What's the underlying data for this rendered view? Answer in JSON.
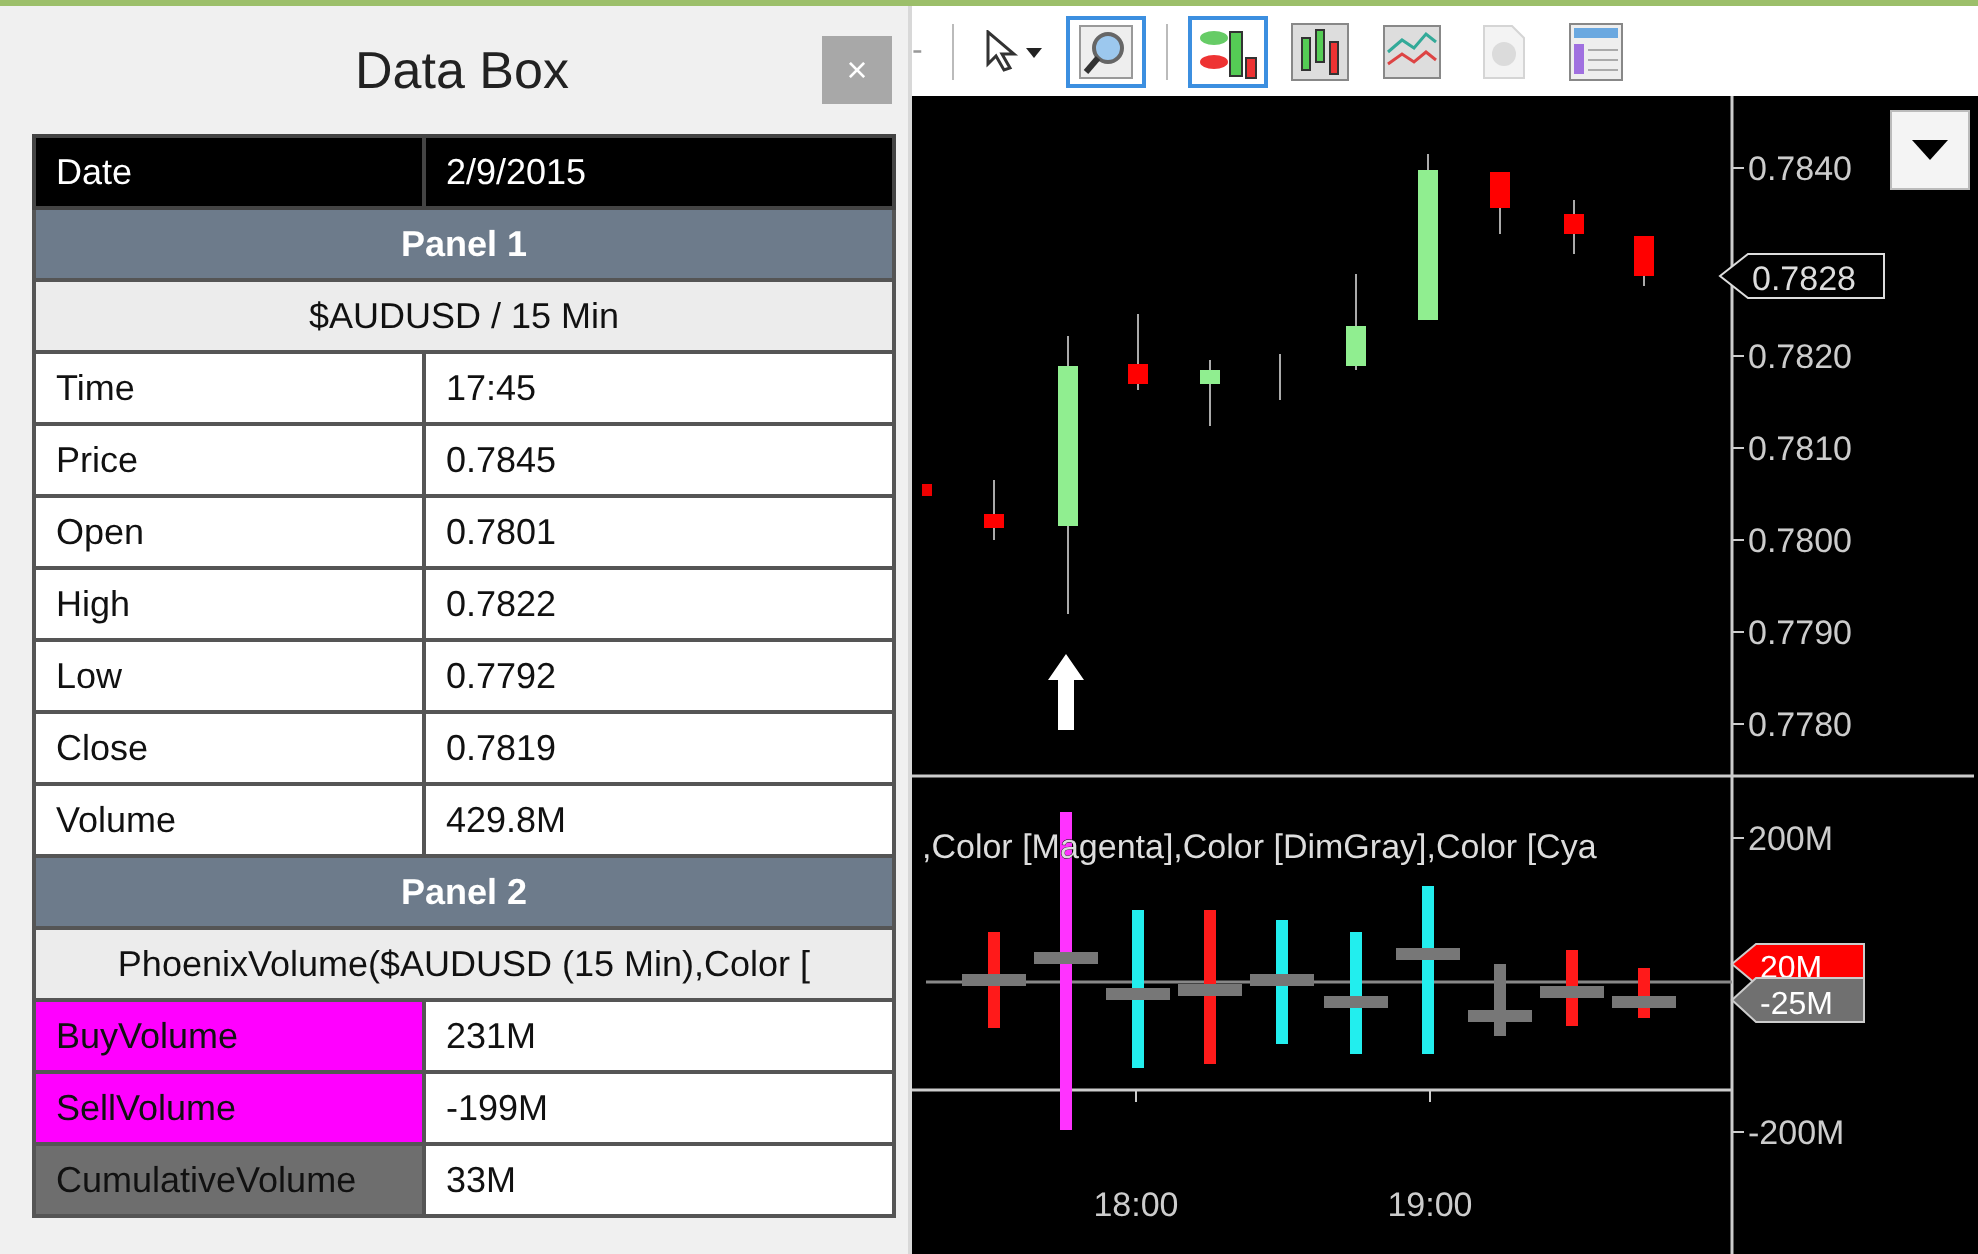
{
  "data_box": {
    "title": "Data Box",
    "close": "×",
    "rows": [
      {
        "kind": "header",
        "label": "Date",
        "value": "2/9/2015"
      },
      {
        "kind": "section",
        "label": "Panel 1"
      },
      {
        "kind": "subtitle",
        "label": "$AUDUSD / 15 Min"
      },
      {
        "kind": "field",
        "label": "Time",
        "value": "17:45"
      },
      {
        "kind": "field",
        "label": "Price",
        "value": "0.7845"
      },
      {
        "kind": "field",
        "label": "Open",
        "value": "0.7801"
      },
      {
        "kind": "field",
        "label": "High",
        "value": "0.7822"
      },
      {
        "kind": "field",
        "label": "Low",
        "value": "0.7792"
      },
      {
        "kind": "field",
        "label": "Close",
        "value": "0.7819"
      },
      {
        "kind": "field",
        "label": "Volume",
        "value": "429.8M"
      },
      {
        "kind": "section",
        "label": "Panel 2"
      },
      {
        "kind": "subtitle",
        "label": "PhoenixVolume($AUDUSD (15 Min),Color ["
      },
      {
        "kind": "field",
        "label": "BuyVolume",
        "value": "231M",
        "color": "#ff00ff"
      },
      {
        "kind": "field",
        "label": "SellVolume",
        "value": "-199M",
        "color": "#ff00ff"
      },
      {
        "kind": "field",
        "label": "CumulativeVolume",
        "value": "33M",
        "color": "#6e6e6e"
      }
    ]
  },
  "toolbar": {
    "partial_label": "-",
    "buttons": [
      {
        "selected": false,
        "disabled": false
      },
      {
        "selected": true,
        "disabled": false
      },
      {
        "selected": true,
        "disabled": false
      },
      {
        "selected": false,
        "disabled": false
      },
      {
        "selected": false,
        "disabled": false
      },
      {
        "selected": false,
        "disabled": true
      },
      {
        "selected": false,
        "disabled": false
      }
    ]
  },
  "chart": {
    "price_ticks": [
      "0.7840",
      "0.7820",
      "0.7810",
      "0.7800",
      "0.7790",
      "0.7780"
    ],
    "current_price": "0.7828",
    "volume_legend": ",Color [Magenta],Color [DimGray],Color [Cya",
    "volume_ticks": [
      "200M",
      "-200M"
    ],
    "volume_tags": [
      {
        "label": "20M",
        "color": "#ff0000"
      },
      {
        "label": "-25M",
        "color": "#707070"
      }
    ],
    "time_ticks": [
      "18:00",
      "19:00"
    ]
  }
}
